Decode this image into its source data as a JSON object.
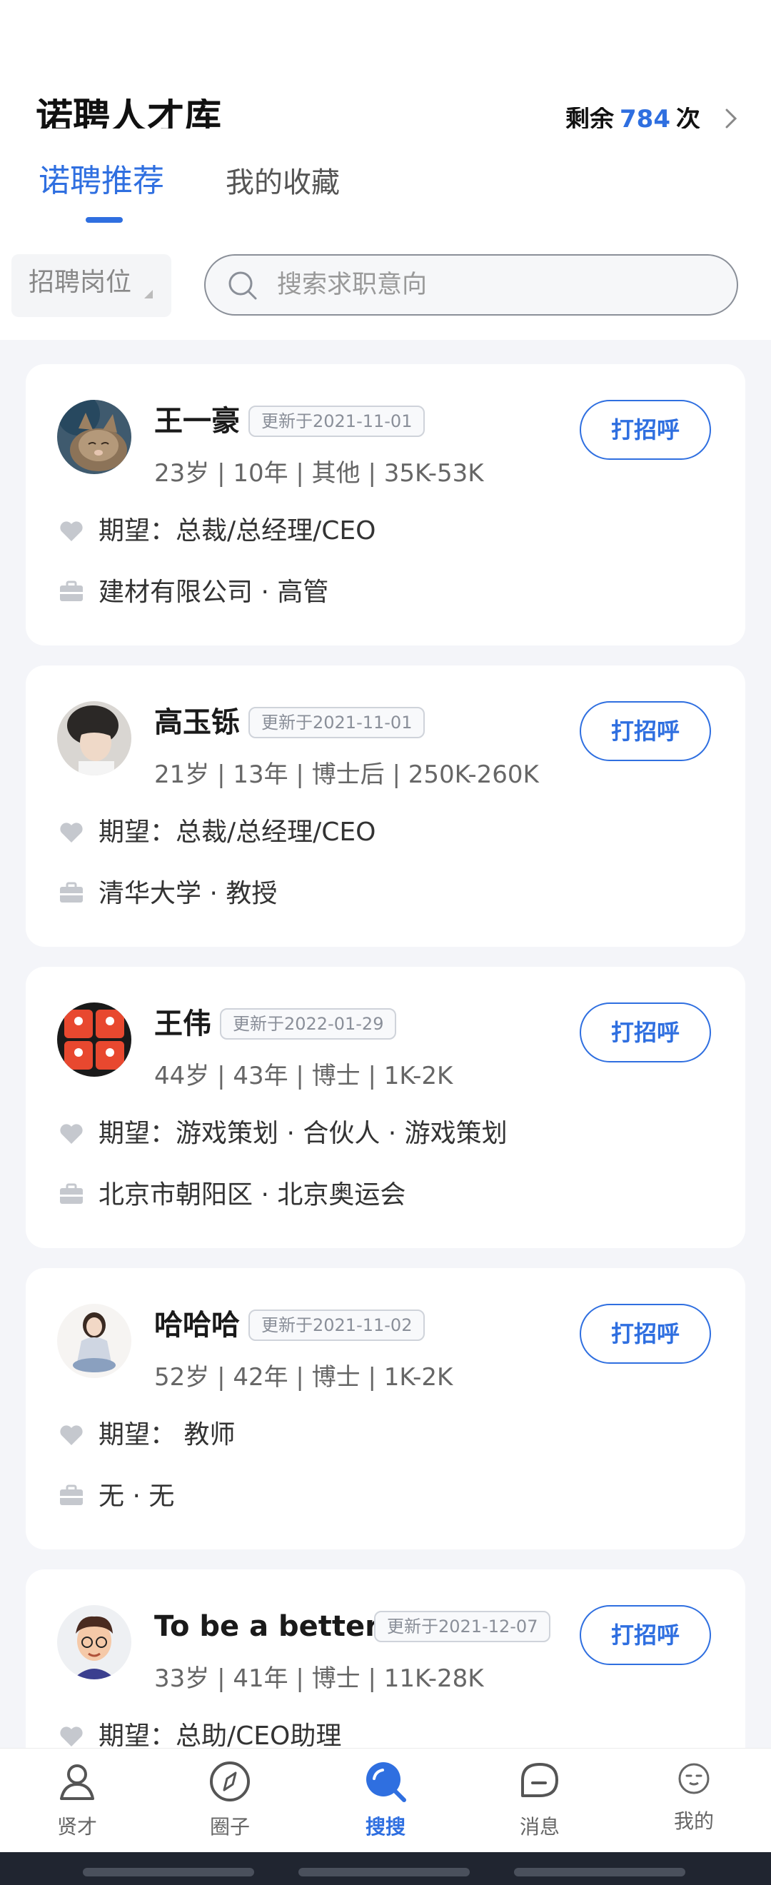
{
  "header": {
    "title": "诺聘人才库",
    "quota_prefix": "剩余",
    "quota_value": "784",
    "quota_suffix": "次"
  },
  "tabs": [
    {
      "label": "诺聘推荐",
      "active": true
    },
    {
      "label": "我的收藏",
      "active": false
    }
  ],
  "filter": {
    "label": "招聘岗位"
  },
  "search": {
    "placeholder": "搜索求职意向"
  },
  "candidates": [
    {
      "name": "王一豪",
      "updated": "更新于2021-11-01",
      "meta": "23岁 | 10年 | 其他 | 35K-53K",
      "expect": "期望：总裁/总经理/CEO",
      "company": "建材有限公司 · 高管",
      "action": "打招呼",
      "avatar": "cat-avatar"
    },
    {
      "name": "高玉铄",
      "updated": "更新于2021-11-01",
      "meta": "21岁 | 13年 | 博士后 | 250K-260K",
      "expect": "期望：总裁/总经理/CEO",
      "company": "清华大学 · 教授",
      "action": "打招呼",
      "avatar": "person-avatar"
    },
    {
      "name": "王伟",
      "updated": "更新于2022-01-29",
      "meta": "44岁 | 43年 | 博士 | 1K-2K",
      "expect": "期望：游戏策划 · 合伙人 · 游戏策划",
      "company": "北京市朝阳区 · 北京奥运会",
      "action": "打招呼",
      "avatar": "timer-grid-avatar"
    },
    {
      "name": "哈哈哈",
      "updated": "更新于2021-11-02",
      "meta": "52岁 | 42年 | 博士 | 1K-2K",
      "expect": "期望： 教师",
      "company": "无 · 无",
      "action": "打招呼",
      "avatar": "girl-avatar"
    },
    {
      "name": "To be a better...",
      "updated": "更新于2021-12-07",
      "meta": "33岁 | 41年 | 博士 | 11K-28K",
      "expect": "期望：总助/CEO助理",
      "company": "",
      "action": "打招呼",
      "avatar": "cartoon-avatar"
    }
  ],
  "nav": [
    {
      "label": "贤才",
      "icon": "person-icon",
      "active": false
    },
    {
      "label": "圈子",
      "icon": "compass-icon",
      "active": false
    },
    {
      "label": "搜搜",
      "icon": "search-icon",
      "active": true
    },
    {
      "label": "消息",
      "icon": "message-icon",
      "active": false
    },
    {
      "label": "我的",
      "icon": "face-icon",
      "active": false
    }
  ],
  "colors": {
    "accent": "#2f6fe0",
    "background": "#f4f5f9"
  }
}
